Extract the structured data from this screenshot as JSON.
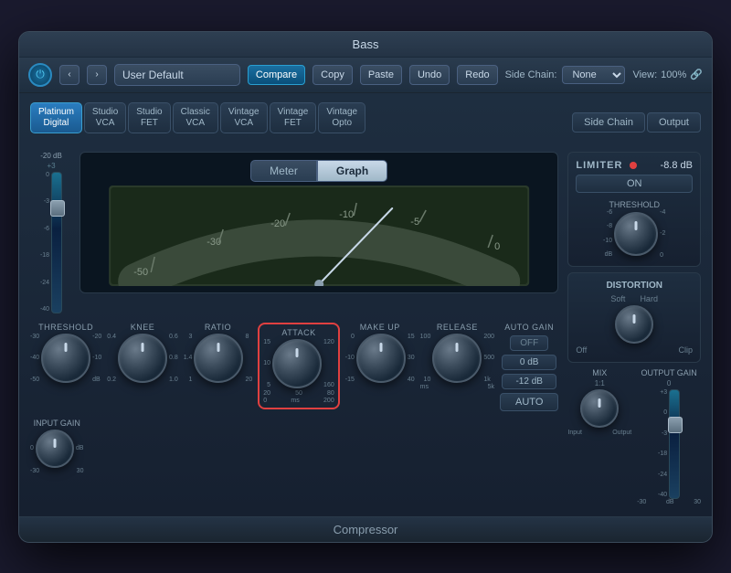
{
  "window": {
    "title": "Bass",
    "bottom_label": "Compressor"
  },
  "header": {
    "preset_value": "User Default",
    "compare_label": "Compare",
    "copy_label": "Copy",
    "paste_label": "Paste",
    "undo_label": "Undo",
    "redo_label": "Redo",
    "side_chain_label": "Side Chain:",
    "side_chain_value": "None",
    "view_label": "View:",
    "view_value": "100%"
  },
  "preset_tabs": [
    {
      "id": "platinum",
      "label": "Platinum\nDigital",
      "active": true
    },
    {
      "id": "studio-vca",
      "label": "Studio\nVCA",
      "active": false
    },
    {
      "id": "studio-fet",
      "label": "Studio\nFET",
      "active": false
    },
    {
      "id": "classic-vca",
      "label": "Classic\nVCA",
      "active": false
    },
    {
      "id": "vintage-vca",
      "label": "Vintage\nVCA",
      "active": false
    },
    {
      "id": "vintage-fet",
      "label": "Vintage\nFET",
      "active": false
    },
    {
      "id": "vintage-opto",
      "label": "Vintage\nOpto",
      "active": false
    }
  ],
  "view_tabs": [
    {
      "id": "side-chain",
      "label": "Side Chain"
    },
    {
      "id": "output",
      "label": "Output"
    }
  ],
  "meter": {
    "meter_tab": "Meter",
    "graph_tab": "Graph",
    "scale_values": [
      "-50",
      "-30",
      "-20",
      "-10",
      "-5",
      "0"
    ]
  },
  "controls": {
    "input_gain": {
      "label": "INPUT GAIN",
      "top_value": "-20 dB",
      "db_label": "dB",
      "scale_neg": "-30",
      "scale_pos": "30"
    },
    "threshold": {
      "label": "THRESHOLD",
      "scales_top": [
        "-30",
        "-20"
      ],
      "scales_mid": [
        "-40",
        "-10"
      ],
      "scales_bot": [
        "-50",
        "dB"
      ]
    },
    "knee": {
      "label": "KNEE",
      "scales": [
        "0.2",
        "0.4",
        "0.6",
        "0.8",
        "1.0"
      ]
    },
    "ratio": {
      "label": "RATIO",
      "scales_top": [
        "3",
        "8"
      ],
      "scales_mid": [
        "1.4",
        "20"
      ],
      "scales_bot": [
        "1"
      ]
    },
    "attack": {
      "label": "ATTACK",
      "scales_top": [
        "20",
        "50",
        "80"
      ],
      "scales_mid": [
        "15",
        "120"
      ],
      "scales_bot": [
        "10",
        "160"
      ],
      "scales_low": [
        "5"
      ],
      "scale_bottom": [
        "0",
        "ms",
        "200"
      ]
    },
    "make_up": {
      "label": "MAKE UP",
      "scales_top": [
        "0",
        "15"
      ],
      "scales_mid": [
        "-10",
        "30"
      ],
      "scales_bot": [
        "-15",
        "40"
      ]
    },
    "release": {
      "label": "RELEASE",
      "scales": [
        "100",
        "200",
        "500",
        "1k",
        "5k"
      ],
      "scale_mid": "10",
      "scale_bot": "ms"
    },
    "auto_gain": {
      "label": "AUTO GAIN",
      "off_label": "OFF",
      "zero_db": "0 dB",
      "minus12": "-12 dB",
      "auto_label": "AUTO"
    }
  },
  "right_panel": {
    "limiter_label": "LIMITER",
    "limiter_value": "-8.8 dB",
    "on_label": "ON",
    "threshold_label": "THRESHOLD",
    "threshold_scales": [
      "-6",
      "-4",
      "-8",
      "-2",
      "-10",
      "dB",
      "0"
    ],
    "distortion_label": "DISTORTION",
    "soft_label": "Soft",
    "hard_label": "Hard",
    "off_label": "Off",
    "clip_label": "Clip",
    "mix_label": "MIX",
    "mix_ratio": "1:1",
    "input_label": "Input",
    "output_label": "Output",
    "output_gain_label": "OUTPUT GAIN",
    "output_scale_neg": "-30",
    "output_scale_pos": "30"
  }
}
